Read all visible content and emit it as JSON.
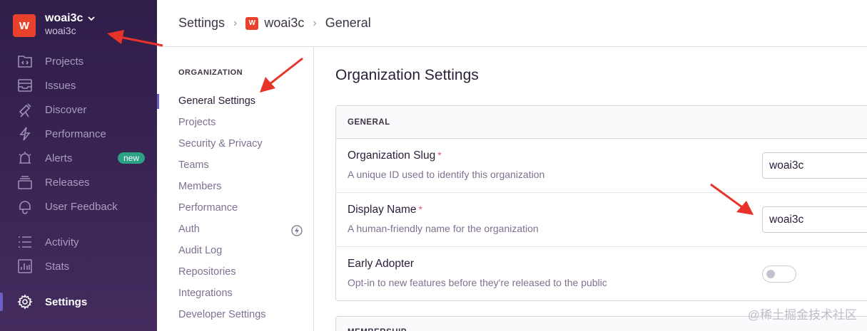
{
  "org": {
    "avatar_letter": "W",
    "name": "woai3c",
    "slug": "woai3c"
  },
  "sidebar": {
    "items": [
      {
        "label": "Projects",
        "icon": "projects-icon"
      },
      {
        "label": "Issues",
        "icon": "issues-icon"
      },
      {
        "label": "Discover",
        "icon": "discover-icon"
      },
      {
        "label": "Performance",
        "icon": "performance-icon"
      },
      {
        "label": "Alerts",
        "icon": "alerts-icon",
        "badge": "new"
      },
      {
        "label": "Releases",
        "icon": "releases-icon"
      },
      {
        "label": "User Feedback",
        "icon": "user-feedback-icon"
      },
      {
        "label": "Activity",
        "icon": "activity-icon"
      },
      {
        "label": "Stats",
        "icon": "stats-icon"
      },
      {
        "label": "Settings",
        "icon": "settings-icon",
        "active": true
      }
    ]
  },
  "breadcrumb": {
    "root": "Settings",
    "org_letter": "W",
    "org": "woai3c",
    "current": "General"
  },
  "settings_nav": {
    "section_title": "ORGANIZATION",
    "items": [
      {
        "label": "General Settings",
        "active": true
      },
      {
        "label": "Projects"
      },
      {
        "label": "Security & Privacy"
      },
      {
        "label": "Teams"
      },
      {
        "label": "Members"
      },
      {
        "label": "Performance"
      },
      {
        "label": "Auth",
        "icon": "bolt-icon"
      },
      {
        "label": "Audit Log"
      },
      {
        "label": "Repositories"
      },
      {
        "label": "Integrations"
      },
      {
        "label": "Developer Settings"
      }
    ]
  },
  "main": {
    "title": "Organization Settings",
    "general_panel": {
      "header": "GENERAL",
      "rows": [
        {
          "label": "Organization Slug",
          "required": "*",
          "help": "A unique ID used to identify this organization",
          "value": "woai3c"
        },
        {
          "label": "Display Name",
          "required": "*",
          "help": "A human-friendly name for the organization",
          "value": "woai3c"
        },
        {
          "label": "Early Adopter",
          "help": "Opt-in to new features before they're released to the public",
          "toggle_on": false
        }
      ]
    },
    "membership_panel_header": "MEMBERSHIP"
  },
  "watermark": "@稀土掘金技术社区",
  "colors": {
    "sidebar_bg": "#3a2555",
    "accent": "#6c5fc7",
    "org_avatar": "#e8412c",
    "badge_new": "#2ba185",
    "required": "#e0557a",
    "annotation_arrow": "#e8332a"
  }
}
